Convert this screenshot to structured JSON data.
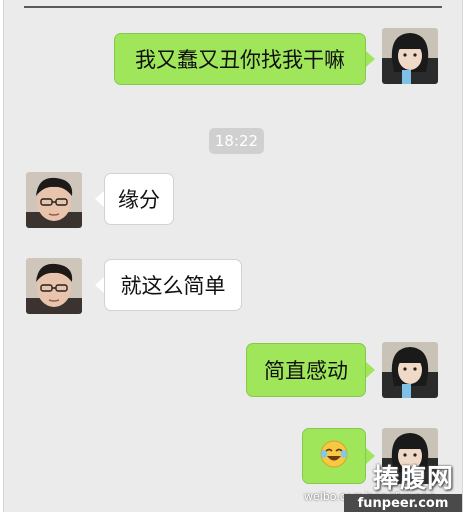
{
  "messages": [
    {
      "side": "sent",
      "text": "我又蠢又丑你找我干嘛"
    },
    {
      "side": "recv",
      "text": "缘分"
    },
    {
      "side": "recv",
      "text": "就这么简单"
    },
    {
      "side": "sent",
      "text": "简直感动"
    },
    {
      "side": "sent",
      "emoji": "tears-of-joy-emoji"
    }
  ],
  "timestamp": "18:22",
  "watermark": {
    "logo": "捧腹网",
    "weibo": "weibo.com/pengfuwang",
    "site": "funpeer.com"
  },
  "colors": {
    "background": "#ebebeb",
    "sent_bubble": "#9fe65b",
    "recv_bubble": "#ffffff",
    "timestamp_bg": "#d0d0d0"
  }
}
